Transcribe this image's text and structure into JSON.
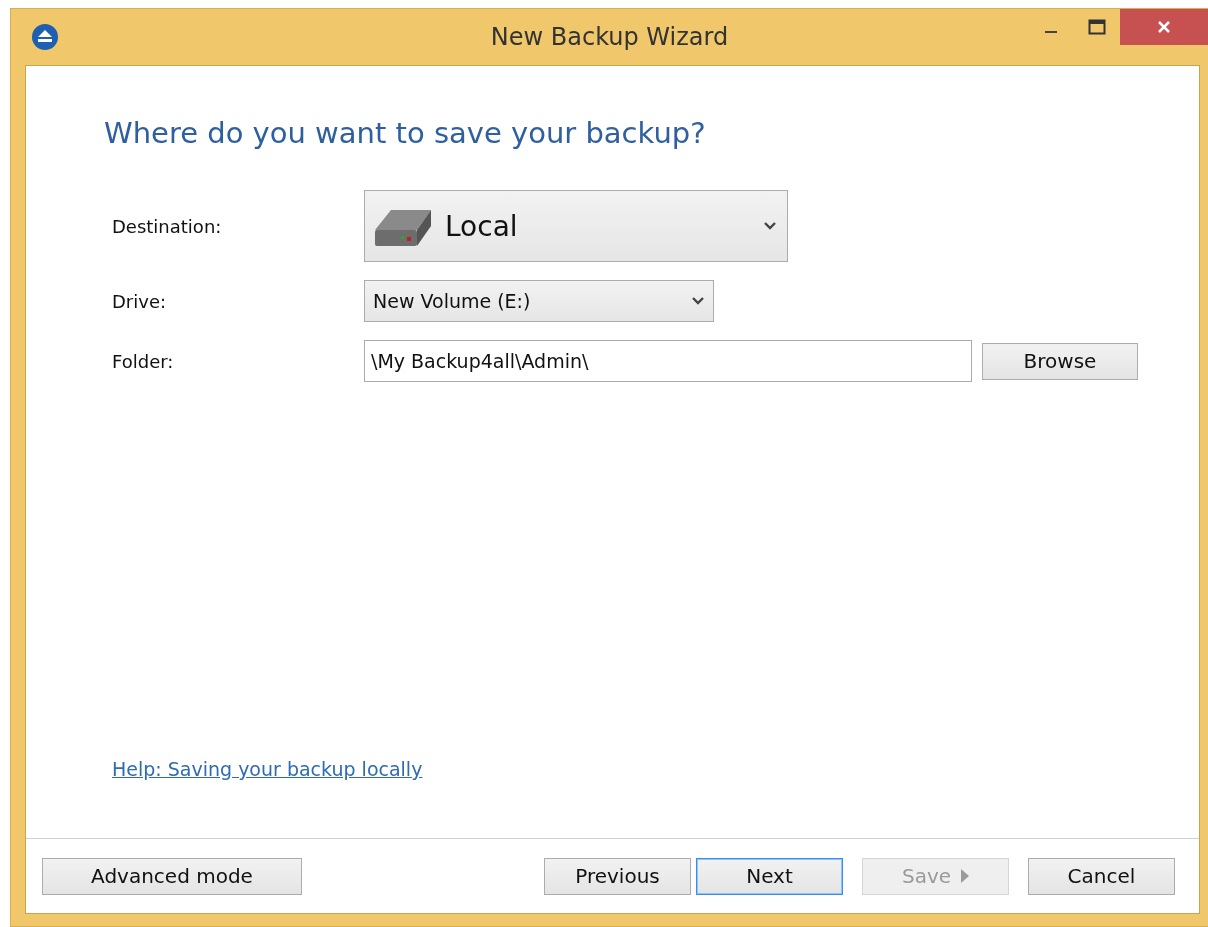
{
  "window": {
    "title": "New Backup Wizard"
  },
  "heading": "Where do you want to save your backup?",
  "form": {
    "destination": {
      "label": "Destination:",
      "value": "Local"
    },
    "drive": {
      "label": "Drive:",
      "value": "New Volume (E:)"
    },
    "folder": {
      "label": "Folder:",
      "value": "\\My Backup4all\\Admin\\",
      "button": "Browse"
    }
  },
  "help_link": "Help: Saving your backup locally",
  "left_button": {
    "label": "Advanced mode"
  },
  "buttons": [
    {
      "label": "Previous",
      "kind": "plain",
      "disabled": false,
      "focused": false
    },
    {
      "label": "Next",
      "kind": "plain",
      "disabled": false,
      "focused": true
    },
    {
      "label": "Save",
      "kind": "menu",
      "disabled": true,
      "focused": false
    },
    {
      "label": "Cancel",
      "kind": "plain",
      "disabled": false,
      "focused": false
    }
  ]
}
